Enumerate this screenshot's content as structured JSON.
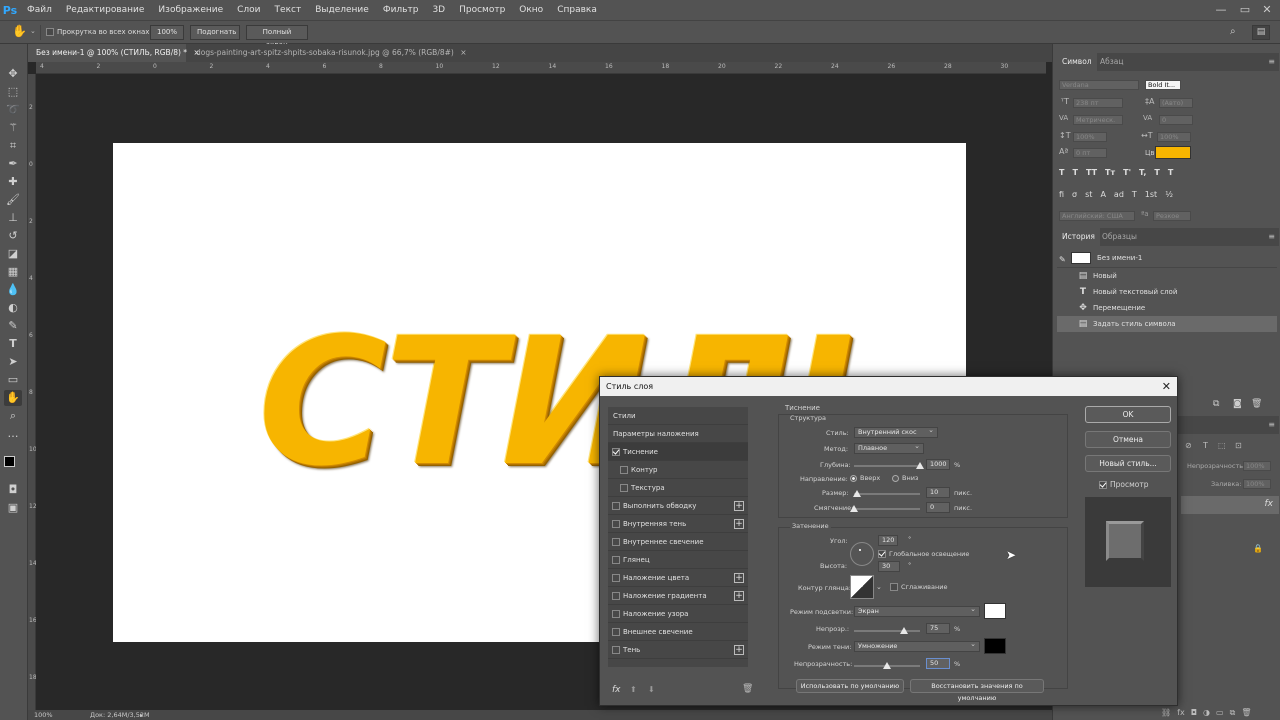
{
  "menubar": {
    "logo": "Ps",
    "items": [
      "Файл",
      "Редактирование",
      "Изображение",
      "Слои",
      "Текст",
      "Выделение",
      "Фильтр",
      "3D",
      "Просмотр",
      "Окно",
      "Справка"
    ]
  },
  "options_bar": {
    "scroll_all_label": "Прокрутка во всех окнах",
    "zoom_btn": "100%",
    "fit_btn": "Подогнать",
    "fullscreen_btn": "Полный экран"
  },
  "tabs": [
    {
      "label": "Без имени-1 @ 100% (СТИЛЬ, RGB/8) *",
      "close": "×"
    },
    {
      "label": "dogs-painting-art-spitz-shpits-sobaka-risunok.jpg @ 66,7% (RGB/8#)",
      "close": "×"
    }
  ],
  "ruler_h": [
    "4",
    "2",
    "0",
    "2",
    "4",
    "6",
    "8",
    "10",
    "12",
    "14",
    "16",
    "18",
    "20",
    "22",
    "24",
    "26",
    "28",
    "30"
  ],
  "ruler_v": [
    "2",
    "0",
    "2",
    "4",
    "6",
    "8",
    "10",
    "12",
    "14",
    "16",
    "18"
  ],
  "canvas": {
    "text": "СТИЛЬ",
    "text_color": "#f7b500",
    "bg": "#ffffff"
  },
  "status": {
    "zoom": "100%",
    "doc": "Док: 2,64М/3,52М"
  },
  "char_panel": {
    "tabs": [
      "Символ",
      "Абзац"
    ],
    "font_family": "Verdana",
    "font_style": "Bold It...",
    "size": "238 пт",
    "leading": "(Авто)",
    "kerning": "Метрическ.",
    "tracking": "0",
    "vscale": "100%",
    "hscale": "100%",
    "baseline": "0 пт",
    "color_label": "Цвет:",
    "color": "#f7b500",
    "language": "Английский: США",
    "aa": "Резкое",
    "style_buttons": [
      "T",
      "T",
      "TT",
      "Tт",
      "T'",
      "T,",
      "T",
      "T"
    ],
    "ot_buttons": [
      "fi",
      "σ",
      "st",
      "A",
      "ad",
      "T",
      "1st",
      "½"
    ]
  },
  "history_panel": {
    "tabs": [
      "История",
      "Образцы"
    ],
    "snapshot": "Без имени-1",
    "items": [
      "Новый",
      "Новый текстовый слой",
      "Перемещение",
      "Задать стиль символа"
    ]
  },
  "layers_panel": {
    "opacity_label": "Непрозрачность:",
    "opacity": "100%",
    "fill_label": "Заливка:",
    "fill": "100%"
  },
  "dialog": {
    "title": "Стиль слоя",
    "close": "✕",
    "list": [
      {
        "label": "Стили",
        "checkbox": false,
        "checked": false,
        "plus": false,
        "indent": false
      },
      {
        "label": "Параметры наложения",
        "checkbox": false,
        "checked": false,
        "plus": false,
        "indent": false
      },
      {
        "label": "Тиснение",
        "checkbox": true,
        "checked": true,
        "plus": false,
        "indent": false
      },
      {
        "label": "Контур",
        "checkbox": true,
        "checked": false,
        "plus": false,
        "indent": true
      },
      {
        "label": "Текстура",
        "checkbox": true,
        "checked": false,
        "plus": false,
        "indent": true
      },
      {
        "label": "Выполнить обводку",
        "checkbox": true,
        "checked": false,
        "plus": true,
        "indent": false
      },
      {
        "label": "Внутренняя тень",
        "checkbox": true,
        "checked": false,
        "plus": true,
        "indent": false
      },
      {
        "label": "Внутреннее свечение",
        "checkbox": true,
        "checked": false,
        "plus": false,
        "indent": false
      },
      {
        "label": "Глянец",
        "checkbox": true,
        "checked": false,
        "plus": false,
        "indent": false
      },
      {
        "label": "Наложение цвета",
        "checkbox": true,
        "checked": false,
        "plus": true,
        "indent": false
      },
      {
        "label": "Наложение градиента",
        "checkbox": true,
        "checked": false,
        "plus": true,
        "indent": false
      },
      {
        "label": "Наложение узора",
        "checkbox": true,
        "checked": false,
        "plus": false,
        "indent": false
      },
      {
        "label": "Внешнее свечение",
        "checkbox": true,
        "checked": false,
        "plus": false,
        "indent": false
      },
      {
        "label": "Тень",
        "checkbox": true,
        "checked": false,
        "plus": true,
        "indent": false
      }
    ],
    "section_title": "Тиснение",
    "structure": {
      "title": "Структура",
      "style_label": "Стиль:",
      "style": "Внутренний скос",
      "technique_label": "Метод:",
      "technique": "Плавное",
      "depth_label": "Глубина:",
      "depth": "1000",
      "depth_level": 1.0,
      "unit_pct": "%",
      "direction_label": "Направление:",
      "direction_up": "Вверх",
      "direction_down": "Вниз",
      "size_label": "Размер:",
      "size": "10",
      "size_level": 0.04,
      "soften_label": "Смягчение:",
      "soften": "0",
      "soften_level": 0.0,
      "unit_px": "пикс."
    },
    "shading": {
      "title": "Затенение",
      "angle_label": "Угол:",
      "angle": "120",
      "deg": "°",
      "global_light": "Глобальное освещение",
      "altitude_label": "Высота:",
      "altitude": "30",
      "gloss_label": "Контур глянца:",
      "antialias": "Сглаживание",
      "highlight_label": "Режим подсветки:",
      "highlight_mode": "Экран",
      "highlight_color": "#ffffff",
      "highlight_opacity_label": "Непрозр.:",
      "highlight_opacity": "75",
      "highlight_level": 0.75,
      "shadow_label": "Режим тени:",
      "shadow_mode": "Умножение",
      "shadow_color": "#000000",
      "shadow_opacity_label": "Непрозрачность:",
      "shadow_opacity": "50",
      "shadow_level": 0.5,
      "unit_pct": "%"
    },
    "btn_default": "Использовать по умолчанию",
    "btn_reset": "Восстановить значения по умолчанию",
    "ok": "OK",
    "cancel": "Отмена",
    "new_style": "Новый стиль...",
    "preview": "Просмотр"
  }
}
